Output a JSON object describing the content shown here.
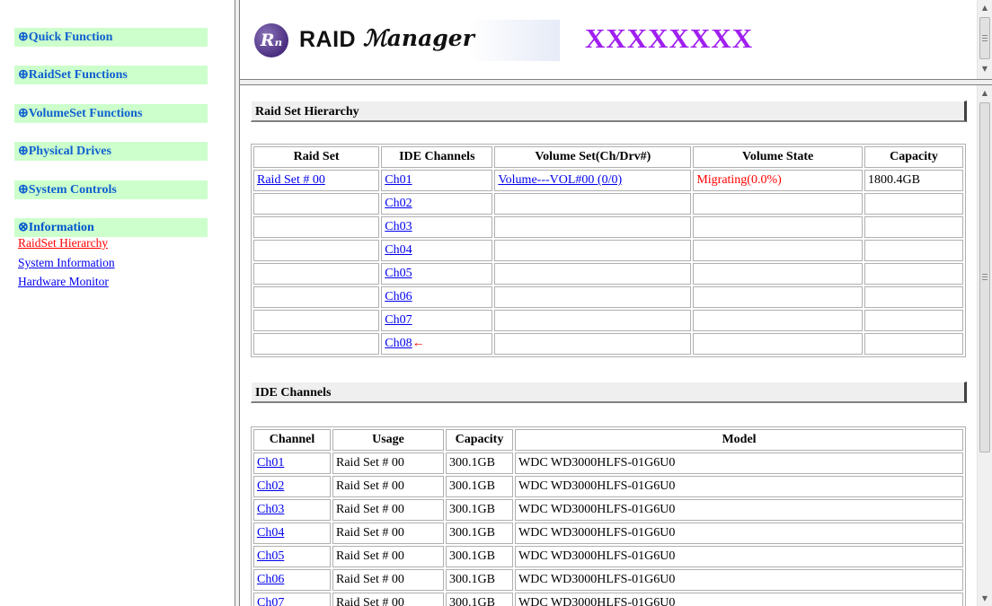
{
  "sidebar": {
    "menus": [
      {
        "label": "⊕Quick Function"
      },
      {
        "label": "⊕RaidSet Functions"
      },
      {
        "label": "⊕VolumeSet Functions"
      },
      {
        "label": "⊕Physical Drives"
      },
      {
        "label": "⊕System Controls"
      },
      {
        "label": "⊗Information"
      }
    ],
    "info_items": [
      {
        "label": "RaidSet Hierarchy",
        "active": true
      },
      {
        "label": "System Information",
        "active": false
      },
      {
        "label": "Hardware Monitor",
        "active": false
      }
    ]
  },
  "banner": {
    "logo_mark": "Rₙ",
    "logo_raid": "RAID",
    "logo_manager": "ℳanager",
    "model": "XXXXXXXX"
  },
  "raid_hierarchy": {
    "title": "Raid Set Hierarchy",
    "headers": [
      "Raid Set",
      "IDE Channels",
      "Volume Set(Ch/Drv#)",
      "Volume State",
      "Capacity"
    ],
    "rows": [
      {
        "raid_set": "Raid Set # 00",
        "channel": "Ch01",
        "volume": "Volume---VOL#00 (0/0)",
        "state": "Migrating(0.0%)",
        "capacity": "1800.4GB"
      },
      {
        "raid_set": "",
        "channel": "Ch02",
        "volume": "",
        "state": "",
        "capacity": ""
      },
      {
        "raid_set": "",
        "channel": "Ch03",
        "volume": "",
        "state": "",
        "capacity": ""
      },
      {
        "raid_set": "",
        "channel": "Ch04",
        "volume": "",
        "state": "",
        "capacity": ""
      },
      {
        "raid_set": "",
        "channel": "Ch05",
        "volume": "",
        "state": "",
        "capacity": ""
      },
      {
        "raid_set": "",
        "channel": "Ch06",
        "volume": "",
        "state": "",
        "capacity": ""
      },
      {
        "raid_set": "",
        "channel": "Ch07",
        "volume": "",
        "state": "",
        "capacity": ""
      },
      {
        "raid_set": "",
        "channel": "Ch08",
        "volume": "",
        "state": "",
        "capacity": "",
        "marker": "←"
      }
    ]
  },
  "ide_channels": {
    "title": "IDE Channels",
    "headers": [
      "Channel",
      "Usage",
      "Capacity",
      "Model"
    ],
    "rows": [
      {
        "channel": "Ch01",
        "usage": "Raid Set # 00",
        "capacity": "300.1GB",
        "model": "WDC WD3000HLFS-01G6U0"
      },
      {
        "channel": "Ch02",
        "usage": "Raid Set # 00",
        "capacity": "300.1GB",
        "model": "WDC WD3000HLFS-01G6U0"
      },
      {
        "channel": "Ch03",
        "usage": "Raid Set # 00",
        "capacity": "300.1GB",
        "model": "WDC WD3000HLFS-01G6U0"
      },
      {
        "channel": "Ch04",
        "usage": "Raid Set # 00",
        "capacity": "300.1GB",
        "model": "WDC WD3000HLFS-01G6U0"
      },
      {
        "channel": "Ch05",
        "usage": "Raid Set # 00",
        "capacity": "300.1GB",
        "model": "WDC WD3000HLFS-01G6U0"
      },
      {
        "channel": "Ch06",
        "usage": "Raid Set # 00",
        "capacity": "300.1GB",
        "model": "WDC WD3000HLFS-01G6U0"
      },
      {
        "channel": "Ch07",
        "usage": "Raid Set # 00",
        "capacity": "300.1GB",
        "model": "WDC WD3000HLFS-01G6U0"
      }
    ]
  },
  "colors": {
    "menu_bg": "#ccffcc",
    "menu_text": "#1060d0",
    "link": "#0000ee",
    "active_link": "#ff0000",
    "model_text": "#a020f0",
    "state_text": "#ff0000"
  },
  "icons": {
    "scroll_up": "scroll-up-arrow-icon",
    "scroll_down": "scroll-down-arrow-icon",
    "logo": "raid-manager-logo-icon"
  }
}
